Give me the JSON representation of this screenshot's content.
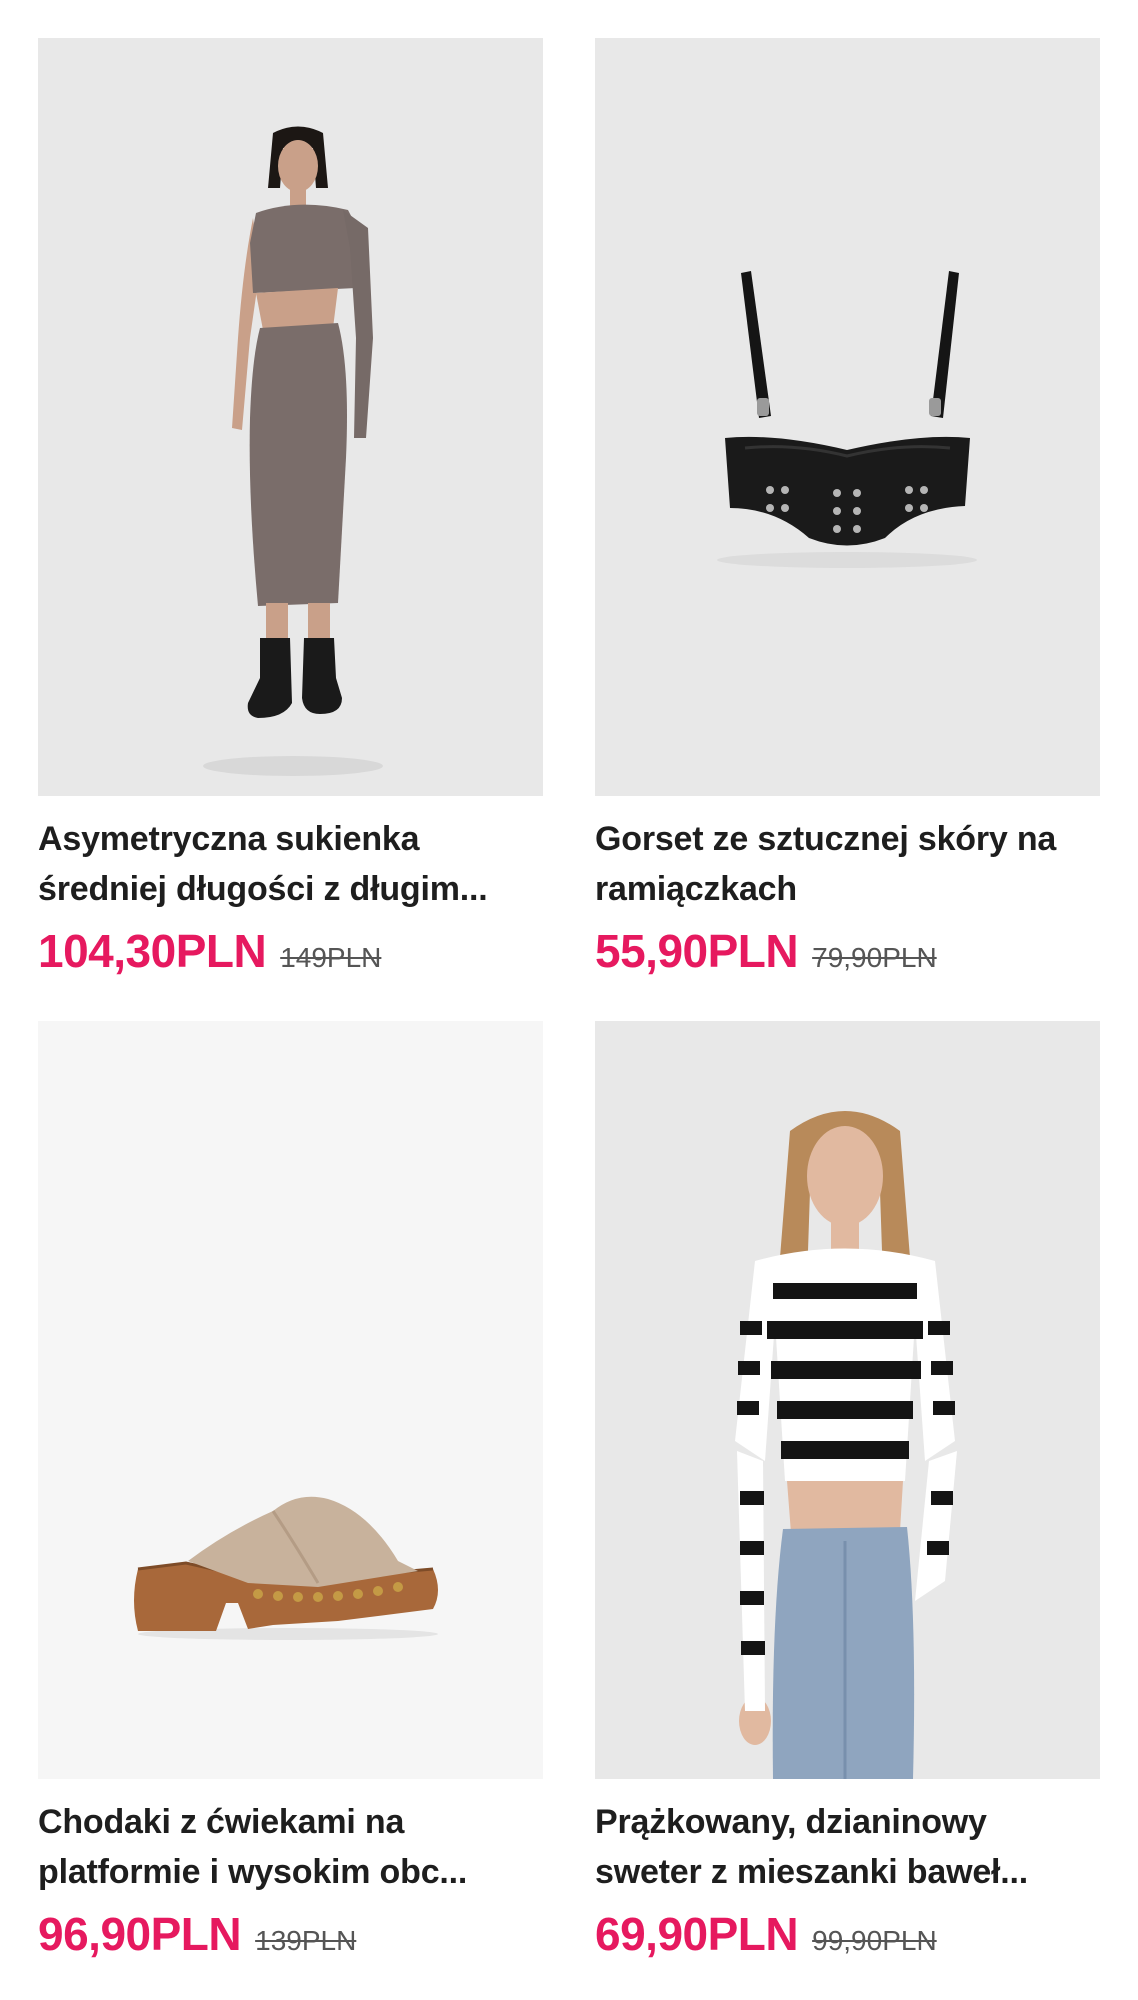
{
  "colors": {
    "accent": "#e6195f",
    "image_bg": "#e9e9e9",
    "image_bg_light": "#f5f5f5",
    "text": "#1e1e1e",
    "old_price": "#555555"
  },
  "products": [
    {
      "title": "Asymetryczna sukienka średniej długości z długim...",
      "price": "104,30PLN",
      "old_price": "149PLN",
      "image": "model-grey-asymmetric-dress"
    },
    {
      "title": "Gorset ze sztucznej skóry na ramiączkach",
      "price": "55,90PLN",
      "old_price": "79,90PLN",
      "image": "black-faux-leather-corset"
    },
    {
      "title": "Chodaki z ćwiekami na platformie i wysokim obc...",
      "price": "96,90PLN",
      "old_price": "139PLN",
      "image": "studded-platform-clog"
    },
    {
      "title": "Prążkowany, dzianinowy sweter z mieszanki baweł...",
      "price": "69,90PLN",
      "old_price": "99,90PLN",
      "image": "model-striped-crop-sweater"
    }
  ]
}
